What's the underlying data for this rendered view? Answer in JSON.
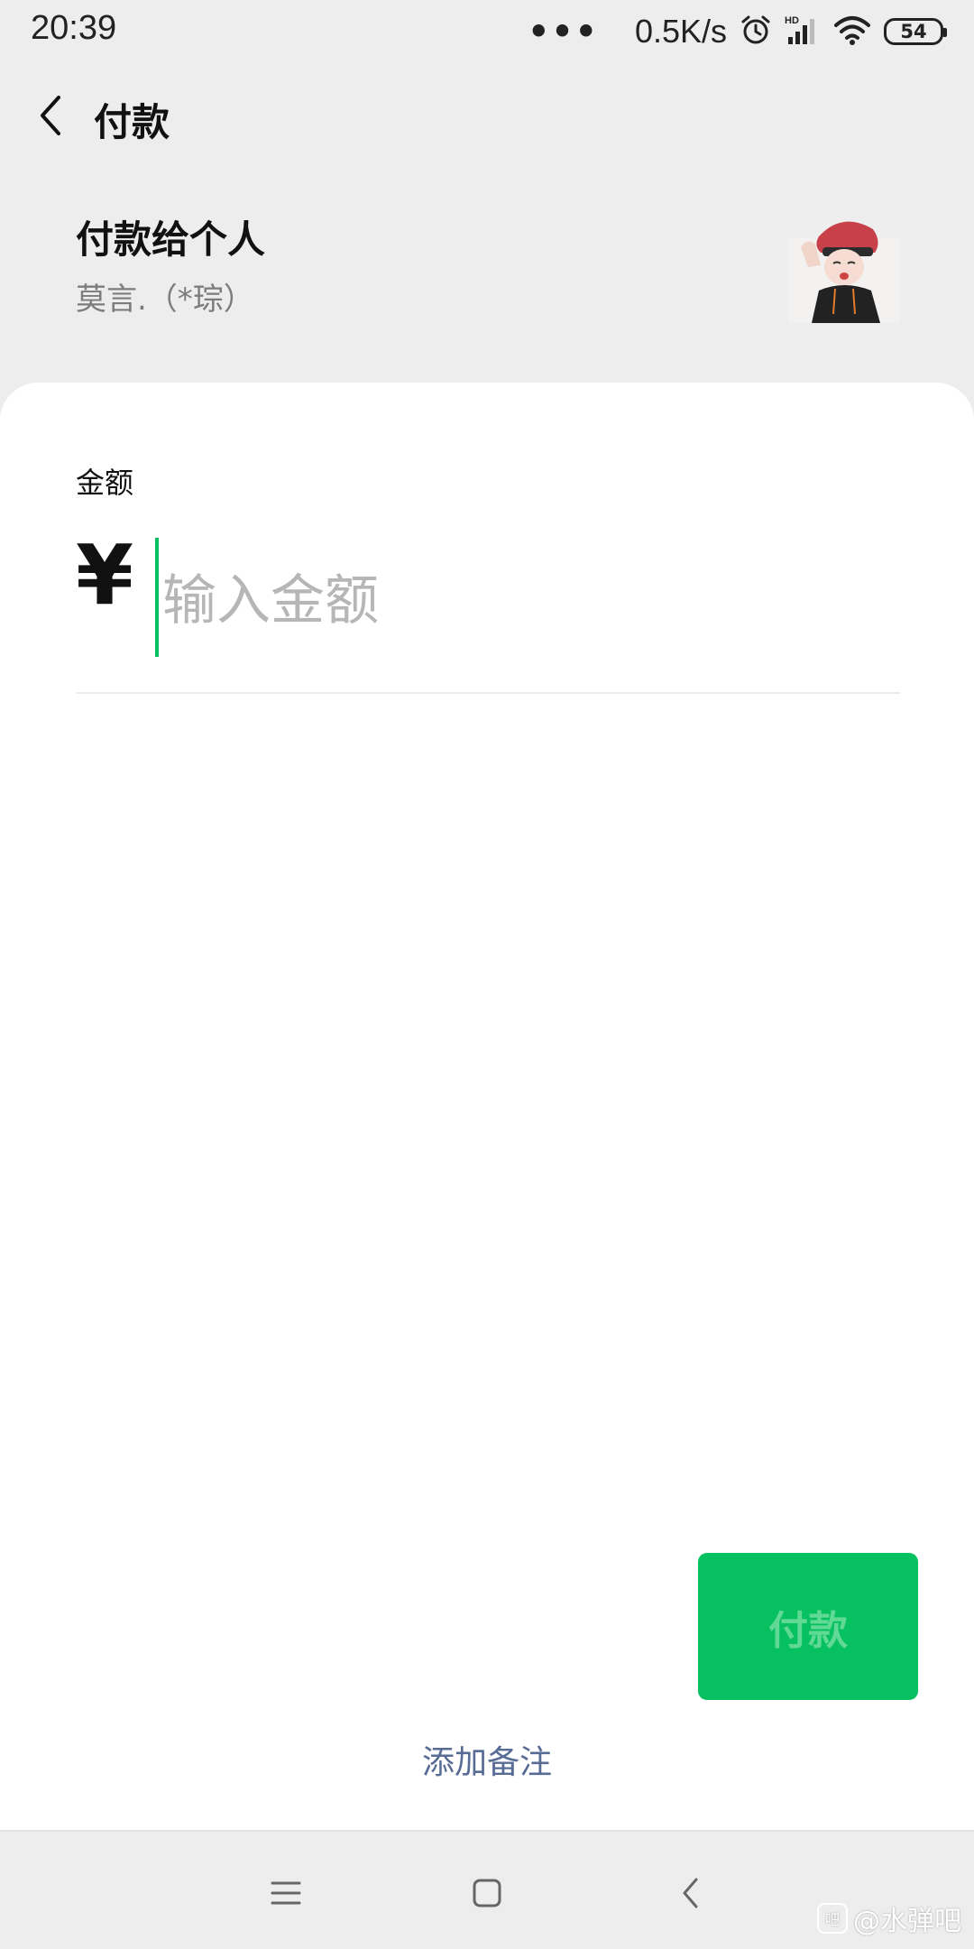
{
  "status_bar": {
    "time": "20:39",
    "more_dots": "•••",
    "network_speed": "0.5K/s",
    "icons": [
      "alarm-icon",
      "hd-signal-icon",
      "wifi-icon",
      "battery-icon"
    ],
    "battery_level": "54"
  },
  "nav": {
    "back_icon": "chevron-left-icon",
    "title": "付款"
  },
  "payee": {
    "title": "付款给个人",
    "name": "莫言.（*琮）",
    "avatar": "avatar-image"
  },
  "amount": {
    "label": "金额",
    "currency_symbol": "¥",
    "placeholder": "输入金额",
    "value": ""
  },
  "actions": {
    "pay_label": "付款",
    "add_note_label": "添加备注"
  },
  "system_nav": {
    "icons": [
      "menu-icon",
      "home-icon",
      "back-icon"
    ]
  },
  "watermark": {
    "text": "@水弹吧",
    "logo_text": "吧"
  },
  "colors": {
    "accent_green": "#07c160",
    "link_blue": "#576b95",
    "page_background": "#ededed",
    "card_background": "#ffffff"
  }
}
